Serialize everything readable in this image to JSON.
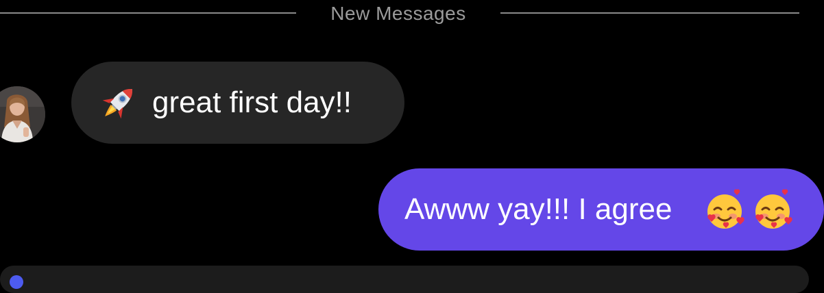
{
  "divider": {
    "label": "New Messages"
  },
  "messages": {
    "incoming": {
      "emoji": "rocket-icon",
      "text": "great first day!!"
    },
    "outgoing": {
      "text": "Awww yay!!! I agree",
      "emojis": [
        "smiling-face-with-hearts-icon",
        "smiling-face-with-hearts-icon"
      ]
    }
  },
  "colors": {
    "background": "#000000",
    "incoming_bubble": "#262626",
    "outgoing_bubble": "#6447e8",
    "divider": "#8a8a8a",
    "text": "#ffffff"
  }
}
